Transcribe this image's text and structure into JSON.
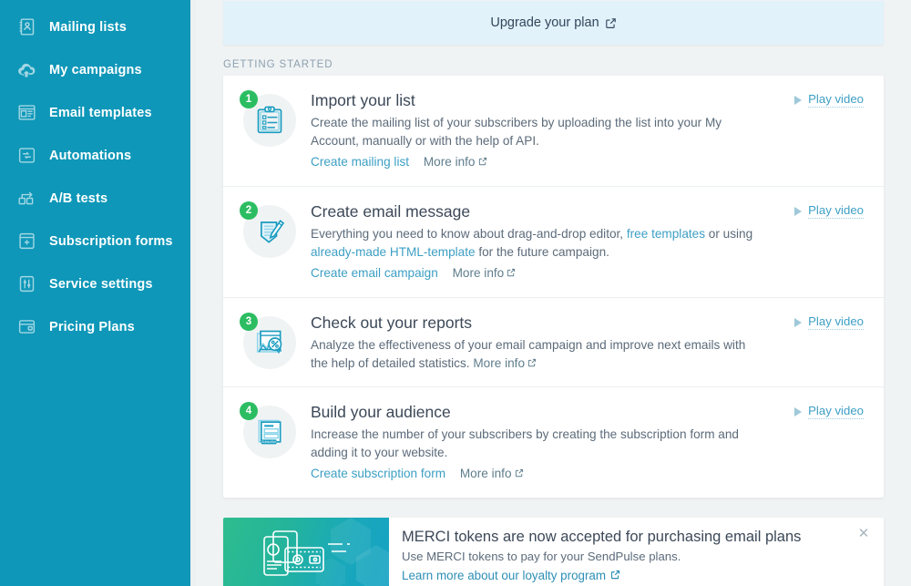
{
  "sidebar": {
    "items": [
      {
        "label": "Mailing lists",
        "icon": "address-book-icon"
      },
      {
        "label": "My campaigns",
        "icon": "upload-cloud-icon"
      },
      {
        "label": "Email templates",
        "icon": "template-grid-icon"
      },
      {
        "label": "Automations",
        "icon": "automation-flow-icon"
      },
      {
        "label": "A/B tests",
        "icon": "ab-split-icon"
      },
      {
        "label": "Subscription forms",
        "icon": "form-plus-icon"
      },
      {
        "label": "Service settings",
        "icon": "sliders-icon"
      },
      {
        "label": "Pricing Plans",
        "icon": "price-tag-icon"
      }
    ],
    "background_color": "#0e97b8"
  },
  "upgrade_bar": {
    "label": "Upgrade your plan",
    "icon": "external-link-icon",
    "background_color": "#e1f2fb"
  },
  "section": {
    "title": "GETTING STARTED"
  },
  "cards": [
    {
      "step": "1",
      "illustration": "clipboard-list-icon",
      "title": "Import your list",
      "desc_parts": [
        {
          "text": "Create the mailing list of your subscribers by uploading the list into your My Account, manually or with the help of API.",
          "link": false
        }
      ],
      "primary_link": "Create mailing list",
      "more_info": "More info",
      "play_video": "Play video"
    },
    {
      "step": "2",
      "illustration": "document-pen-icon",
      "title": "Create email message",
      "desc_parts": [
        {
          "text": "Everything you need to know about drag-and-drop editor, ",
          "link": false
        },
        {
          "text": "free templates",
          "link": true
        },
        {
          "text": " or using ",
          "link": false
        },
        {
          "text": "already-made HTML-template",
          "link": true
        },
        {
          "text": " for the future campaign.",
          "link": false
        }
      ],
      "primary_link": "Create email campaign",
      "more_info": "More info",
      "play_video": "Play video"
    },
    {
      "step": "3",
      "illustration": "report-chart-icon",
      "title": "Check out your reports",
      "desc_parts": [
        {
          "text": "Analyze the effectiveness of your email campaign and improve next emails with the help of detailed statistics. ",
          "link": false
        }
      ],
      "primary_link": "",
      "more_info": "More info",
      "play_video": "Play video"
    },
    {
      "step": "4",
      "illustration": "subscribe-form-icon",
      "title": "Build your audience",
      "desc_parts": [
        {
          "text": "Increase the number of your subscribers by creating the subscription form and adding it to your website.",
          "link": false
        }
      ],
      "primary_link": "Create subscription form",
      "more_info": "More info",
      "play_video": "Play video"
    }
  ],
  "promo": {
    "illustration": "wallet-card-icon",
    "title": "MERCI tokens are now accepted for purchasing email plans",
    "subtitle": "Use MERCI tokens to pay for your SendPulse plans.",
    "link": "Learn more about our loyalty program",
    "link_icon": "external-link-icon",
    "close_icon": "close-icon",
    "close_glyph": "✕",
    "gradient_from": "#2ebd8e",
    "gradient_to": "#15a2c4"
  },
  "colors": {
    "accent": "#0e97b8",
    "link": "#3d9fc4",
    "badge_green": "#2cbd62",
    "page_bg": "#f0f3f4"
  }
}
